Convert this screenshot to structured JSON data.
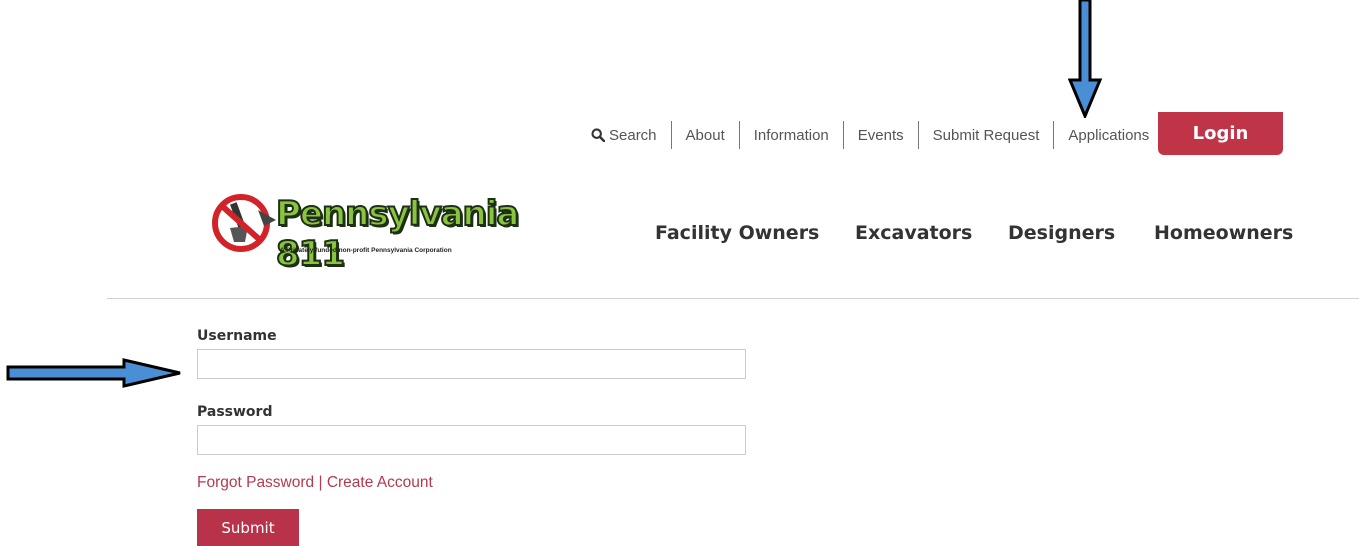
{
  "top_nav": {
    "search": "Search",
    "about": "About",
    "information": "Information",
    "events": "Events",
    "submit_request": "Submit Request",
    "applications": "Applications",
    "login": "Login"
  },
  "logo": {
    "name": "Pennsylvania 811",
    "tagline": "A Privately funded non-profit Pennsylvania Corporation"
  },
  "main_nav": {
    "facility_owners": "Facility Owners",
    "excavators": "Excavators",
    "designers": "Designers",
    "homeowners": "Homeowners"
  },
  "form": {
    "username_label": "Username",
    "username_value": "",
    "password_label": "Password",
    "password_value": "",
    "forgot_password": "Forgot Password",
    "link_separator": "|",
    "create_account": "Create Account",
    "submit": "Submit"
  },
  "colors": {
    "brand_red": "#c03448",
    "link_red": "#b33a4e",
    "annotation_arrow_fill": "#4a8fd6",
    "annotation_arrow_outline": "#000000"
  },
  "icons": {
    "search": "search-icon",
    "logo_emblem": "no-dig-shovel-icon",
    "annotations": [
      "annotation-arrow-down",
      "annotation-arrow-right"
    ]
  }
}
